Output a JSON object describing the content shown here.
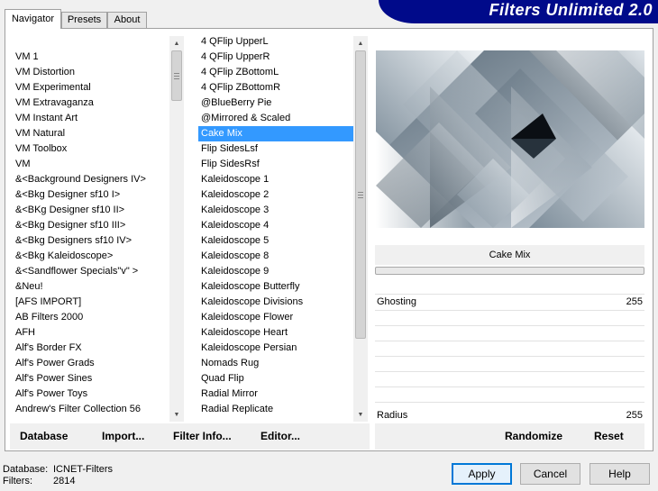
{
  "tabs": [
    {
      "label": "Navigator",
      "active": true
    },
    {
      "label": "Presets",
      "active": false
    },
    {
      "label": "About",
      "active": false
    }
  ],
  "brand": {
    "title": "Filters Unlimited 2.0",
    "color": "#000a8a"
  },
  "categories": [
    "VM 1",
    "VM Distortion",
    "VM Experimental",
    "VM Extravaganza",
    "VM Instant Art",
    "VM Natural",
    "VM Toolbox",
    "VM",
    "&<Background Designers IV>",
    "&<Bkg Designer sf10 I>",
    "&<BKg Designer sf10 II>",
    "&<Bkg Designer sf10 III>",
    "&<Bkg Designers sf10 IV>",
    "&<Bkg Kaleidoscope>",
    "&<Sandflower Specials\"v\" >",
    "&Neu!",
    "[AFS IMPORT]",
    "AB Filters 2000",
    "AFH",
    "Alf's Border FX",
    "Alf's Power Grads",
    "Alf's Power Sines",
    "Alf's Power Toys",
    "Andrew's Filter Collection 56"
  ],
  "filters": [
    "4 QFlip UpperL",
    "4 QFlip UpperR",
    "4 QFlip ZBottomL",
    "4 QFlip ZBottomR",
    "@BlueBerry Pie",
    "@Mirrored & Scaled",
    "Cake Mix",
    "Flip SidesLsf",
    "Flip SidesRsf",
    "Kaleidoscope 1",
    "Kaleidoscope 2",
    "Kaleidoscope 3",
    "Kaleidoscope 4",
    "Kaleidoscope 5",
    "Kaleidoscope 8",
    "Kaleidoscope 9",
    "Kaleidoscope Butterfly",
    "Kaleidoscope Divisions",
    "Kaleidoscope Flower",
    "Kaleidoscope Heart",
    "Kaleidoscope Persian",
    "Nomads Rug",
    "Quad Flip",
    "Radial Mirror",
    "Radial Replicate"
  ],
  "selected_filter_index": 6,
  "selection_color": "#3399ff",
  "current_filter": "Cake Mix",
  "params": [
    {
      "name": "Ghosting",
      "value": "255"
    },
    {
      "name": "Radius",
      "value": "255"
    }
  ],
  "actions": {
    "database": "Database",
    "import": "Import...",
    "filter_info": "Filter Info...",
    "editor": "Editor...",
    "randomize": "Randomize",
    "reset": "Reset"
  },
  "footer": {
    "database_label": "Database:",
    "database_value": "ICNET-Filters",
    "filters_label": "Filters:",
    "filters_value": "2814"
  },
  "buttons": {
    "apply": "Apply",
    "cancel": "Cancel",
    "help": "Help"
  }
}
